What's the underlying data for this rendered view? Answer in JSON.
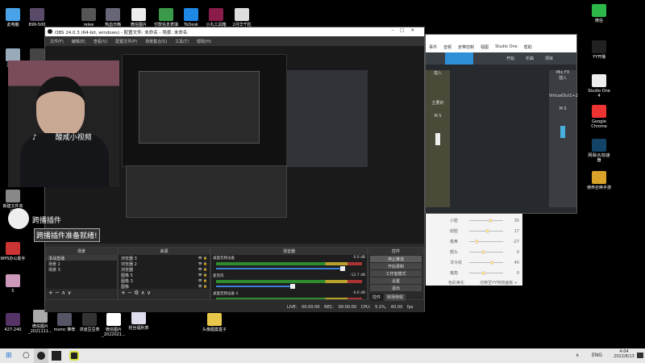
{
  "desktop": {
    "top_icons": [
      "此电脑",
      "899-500",
      "relee",
      "热血日韩",
      "微信图片",
      "付款信息表填",
      "ToDesk",
      "小丸工具箱",
      "2月华千粒"
    ],
    "left_icons": [
      "回收站",
      "1080",
      "新建文件夹(2)",
      "WPS办公助手",
      "5"
    ],
    "bottom_icons": [
      "427-240",
      "微信图片_2021111...",
      "msmc 推荐",
      "求道豆豆表",
      "微信图片_2022021...",
      "轻丝福利表",
      "头像图案盒子"
    ],
    "right_icons": [
      "微信",
      "YY开播",
      "Studio One 4",
      "Google Chrome",
      "网易UU加速器",
      "使命召唤手游"
    ]
  },
  "overlay": {
    "watermark": "酸咸小视频",
    "plugin_label": "跨播插件",
    "plugin_status": "跨播插件准备就绪!"
  },
  "obs": {
    "title": "OBS 24.0.3 (64-bit, windows) - 配置文件: 未命名 - 场景: 未命名",
    "menu": [
      "文件(F)",
      "编辑(E)",
      "查看(V)",
      "配置文件(P)",
      "场景集合(S)",
      "工具(T)",
      "帮助(H)"
    ],
    "docks": {
      "scenes": "场景",
      "sources": "来源",
      "mixer": "混音器",
      "controls": "控件"
    },
    "scenes": [
      "求战直播",
      "场景 2",
      "场景 3"
    ],
    "sources": [
      "浏览器 3",
      "浏览器 2",
      "浏览器",
      "图像 5",
      "图像 3",
      "图像"
    ],
    "mixer": [
      {
        "name": "桌面音频设备",
        "db": "0.0 dB",
        "volume": 0.98
      },
      {
        "name": "麦克风",
        "db": "-12.7 dB",
        "volume": 0.59
      },
      {
        "name": "桌面音频设备 4",
        "db": "0.0 dB"
      }
    ],
    "controls": [
      "停止推流",
      "开始录制",
      "工作室模式",
      "设置",
      "退出"
    ],
    "control_tabs": [
      "控件",
      "转场特效"
    ],
    "status": {
      "live": "LIVE: 00:00:00",
      "rec": "REC: 00:00:00",
      "cpu": "CPU: 5.1%, 60.00 fps"
    }
  },
  "studio_one": {
    "menu": [
      "事件",
      "音频",
      "走带控制",
      "视图",
      "Studio One",
      "帮助"
    ],
    "toolbar": [
      "开始",
      "乐曲",
      "项目"
    ],
    "left_channel": "主要的",
    "mix_fx": "Mix FX",
    "insert": "插入",
    "right_channel": "VirtualOut1+2",
    "ms": [
      "M",
      "S"
    ]
  },
  "yy_beauty": {
    "rows": [
      {
        "label": "小脸",
        "value": "30"
      },
      {
        "label": "削脸",
        "value": "17"
      },
      {
        "label": "瘦鼻",
        "value": "-27"
      },
      {
        "label": "额头",
        "value": "0"
      },
      {
        "label": "法令纹",
        "value": "40"
      },
      {
        "label": "嘴角",
        "value": "0"
      }
    ],
    "footer_left": "色彩美化",
    "footer_right": "切换至YY特效面板 >"
  },
  "taskbar": {
    "lang": "ENG",
    "time": "4:04",
    "date": "2022/6/13"
  }
}
